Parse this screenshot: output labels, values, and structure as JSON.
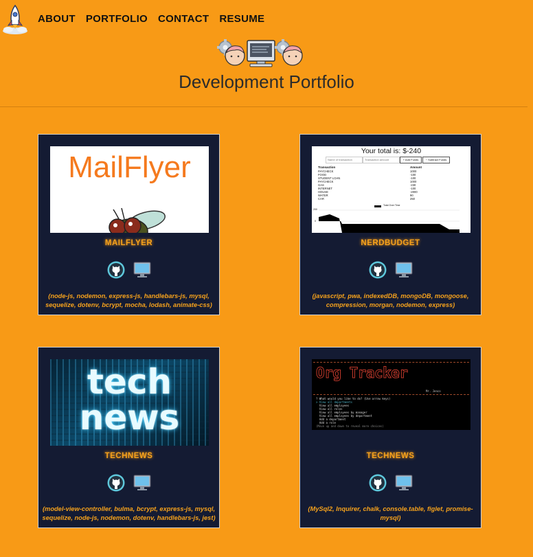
{
  "nav": {
    "links": [
      "ABOUT",
      "PORTFOLIO",
      "CONTACT",
      "RESUME"
    ]
  },
  "page": {
    "title": "Development Portfolio"
  },
  "projects": [
    {
      "title": "MAILFLYER",
      "thumb_text": "MailFlyer",
      "tech": "(node-js, nodemon, express-js, handlebars-js, mysql, sequelize, dotenv, bcrypt, mocha, lodash, animate-css)"
    },
    {
      "title": "NERDBUDGET",
      "thumb_header": "Your total is: $-240",
      "thumb_inputs": [
        "Name of transaction",
        "Transaction amount"
      ],
      "thumb_buttons": [
        "+ Add Funds",
        "− Subtract Funds"
      ],
      "thumb_cols": [
        "Transaction",
        "Amount"
      ],
      "thumb_rows": [
        [
          "PAYCHECK",
          "1000"
        ],
        [
          "FOOD",
          "-100"
        ],
        [
          "STUDENT LOAN",
          "-100"
        ],
        [
          "PAYCHECK",
          "1000"
        ],
        [
          "GAS",
          "-230"
        ],
        [
          "INTERNET",
          "-100"
        ],
        [
          "HOUSE",
          "-2000"
        ],
        [
          "WATER",
          "90"
        ],
        [
          "CAR",
          "250"
        ]
      ],
      "thumb_legend": "Total Over Time",
      "thumb_yticks": [
        "200",
        "0"
      ],
      "tech": "(javascript, pwa, indexedDB, mongoDB, mongoose, compression, morgan, nodemon, express)"
    },
    {
      "title": "TECHNEWS",
      "thumb_words": [
        "tech",
        "news"
      ],
      "tech": "(model-view-controller, bulma, bcrypt, express-js, mysql, sequelize, node-js, nodemon, dotenv, handlebars-js, jest)"
    },
    {
      "title": "TECHNEWS",
      "thumb_banner": "Org Tracker",
      "thumb_author": "Mr. Jenco",
      "thumb_lines": [
        "? What would you like to do? (Use arrow keys)",
        "> View all departments",
        "  View all employees",
        "  View all roles",
        "  View all employees by manager",
        "  View all employees by department",
        "  Add a department",
        "  Add a role",
        "(Move up and down to reveal more choices)"
      ],
      "tech": "(MySql2, Inquirer, chalk, console.table, figlet, promise-mysql)"
    }
  ],
  "colors": {
    "background": "#f89a16",
    "card": "#141b33",
    "accent": "#f6a21c"
  },
  "icons": {
    "logo": "rocket-icon",
    "hero": "developers-computer-icon",
    "repo": "github-icon",
    "demo": "monitor-icon"
  }
}
